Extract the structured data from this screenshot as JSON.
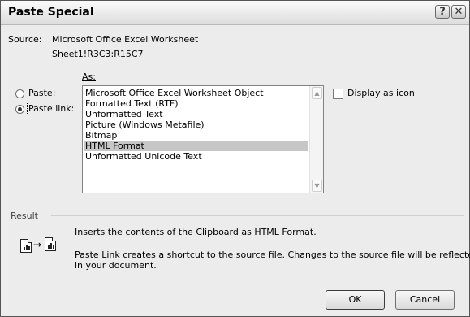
{
  "window": {
    "title": "Paste Special",
    "help_glyph": "?",
    "close_glyph": "✕"
  },
  "source": {
    "label": "Source:",
    "line1": "Microsoft Office Excel Worksheet",
    "line2": "Sheet1!R3C3:R15C7"
  },
  "as_label": "As:",
  "radios": {
    "paste": "Paste:",
    "paste_link": "Paste link:",
    "selected": "paste_link"
  },
  "formats": [
    "Microsoft Office Excel Worksheet Object",
    "Formatted Text (RTF)",
    "Unformatted Text",
    "Picture (Windows Metafile)",
    "Bitmap",
    "HTML Format",
    "Unformatted Unicode Text"
  ],
  "selected_format_index": 5,
  "display_as_icon": {
    "label": "Display as icon",
    "checked": false
  },
  "result": {
    "label": "Result",
    "line1": "Inserts the contents of the Clipboard as HTML Format.",
    "line2": "Paste Link creates a shortcut to the source file. Changes to the source file will be reflected",
    "line3": "in your document."
  },
  "buttons": {
    "ok": "OK",
    "cancel": "Cancel"
  }
}
